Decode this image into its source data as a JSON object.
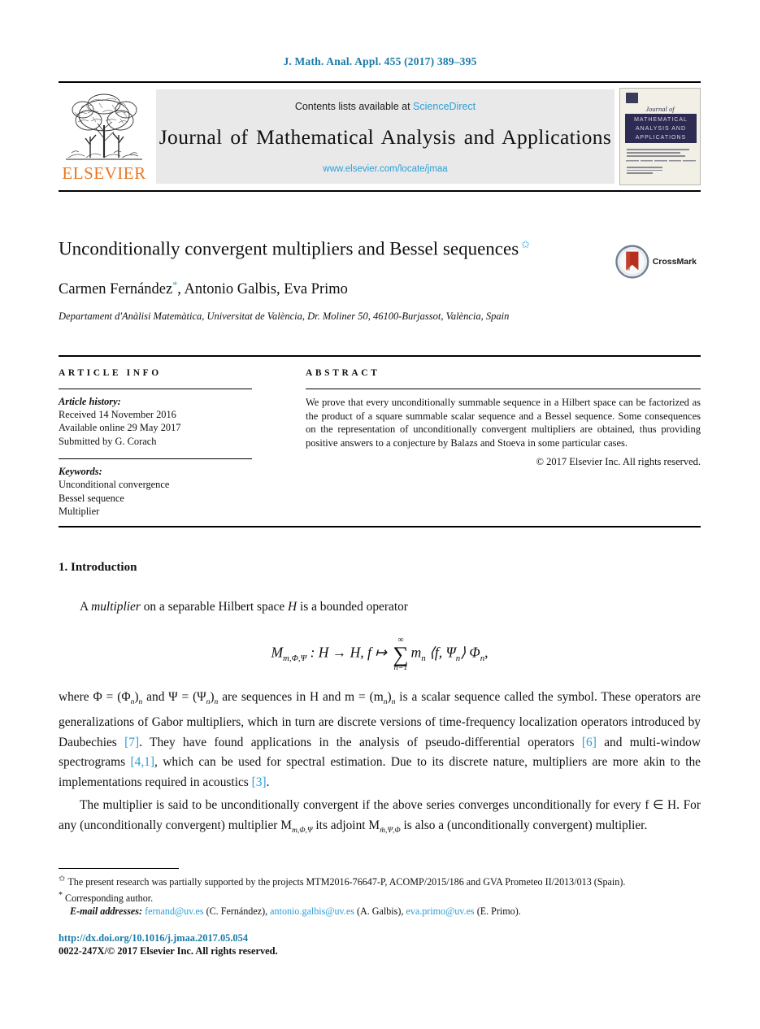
{
  "running_head": "J. Math. Anal. Appl. 455 (2017) 389–395",
  "masthead": {
    "contents_prefix": "Contents lists available at",
    "sciencedirect": "ScienceDirect",
    "journal_title": "Journal of Mathematical Analysis and Applications",
    "journal_url": "www.elsevier.com/locate/jmaa",
    "publisher_wordmark": "ELSEVIER",
    "cover": {
      "journal_of": "Journal of",
      "band_line1": "MATHEMATICAL",
      "band_line2": "ANALYSIS AND",
      "band_line3": "APPLICATIONS"
    }
  },
  "article": {
    "title": "Unconditionally convergent multipliers and Bessel sequences",
    "title_footnote_mark": "✩",
    "authors": "Carmen Fernández",
    "author_star": "*",
    "authors_rest": ", Antonio Galbis, Eva Primo",
    "affiliation": "Departament d'Anàlisi Matemàtica, Universitat de València, Dr. Moliner 50, 46100-Burjassot, València, Spain",
    "crossmark_label": "CrossMark"
  },
  "info": {
    "heading": "ARTICLE INFO",
    "history_label": "Article history:",
    "history": [
      "Received 14 November 2016",
      "Available online 29 May 2017",
      "Submitted by G. Corach"
    ],
    "keywords_label": "Keywords:",
    "keywords": [
      "Unconditional convergence",
      "Bessel sequence",
      "Multiplier"
    ]
  },
  "abstract": {
    "heading": "ABSTRACT",
    "text": "We prove that every unconditionally summable sequence in a Hilbert space can be factorized as the product of a square summable scalar sequence and a Bessel sequence. Some consequences on the representation of unconditionally convergent multipliers are obtained, thus providing positive answers to a conjecture by Balazs and Stoeva in some particular cases.",
    "copyright": "© 2017 Elsevier Inc. All rights reserved."
  },
  "body": {
    "section_heading": "1. Introduction",
    "p1_a": "A ",
    "p1_em": "multiplier",
    "p1_b": " on a separable Hilbert space ",
    "p1_H": "H",
    "p1_c": " is a bounded operator",
    "equation": {
      "operator": "M",
      "operator_sub": "m,Φ,Ψ",
      "maps": " : H → H,  f ↦ ",
      "sum_top": "∞",
      "sum_bot": "n=1",
      "term_m": "m",
      "term_m_sub": "n",
      "inner": " ⟨f, Ψ",
      "inner_sub": "n",
      "inner_close": "⟩ Φ",
      "phi_sub": "n",
      "tail": ","
    },
    "p2_part1": "where Φ = (Φ",
    "p2_part2": ")",
    "p2_text": " and Ψ = (Ψ",
    "p2_text2": " are sequences in H and m = (m",
    "p2_text3": " is a scalar sequence called the symbol. These operators are generalizations of Gabor multipliers, which in turn are discrete versions of time-frequency localization operators introduced by Daubechies ",
    "cite_7": "[7]",
    "p2_text4": ". They have found applications in the analysis of pseudo-differential operators ",
    "cite_6": "[6]",
    "p2_text5": " and multi-window spectrograms ",
    "cite_41": "[4,1]",
    "p2_text6": ", which can be used for spectral estimation. Due to its discrete nature, multipliers are more akin to the implementations required in acoustics ",
    "cite_3": "[3]",
    "p2_text7": ".",
    "p3_text1": "The multiplier is said to be unconditionally convergent if the above series converges unconditionally for every f ∈ H. For any (unconditionally convergent) multiplier M",
    "p3_sub1": "m,Φ,Ψ",
    "p3_text2": " its adjoint M",
    "p3_sub2": "m̄,Ψ,Φ",
    "p3_text3": " is also a (unconditionally convergent) multiplier."
  },
  "footnotes": {
    "funding_mark": "✩",
    "funding": "The present research was partially supported by the projects MTM2016-76647-P, ACOMP/2015/186 and GVA Prometeo II/2013/013 (Spain).",
    "corresponding_mark": "*",
    "corresponding": "Corresponding author.",
    "emails_label": "E-mail addresses:",
    "emails": [
      {
        "address": "fernand@uv.es",
        "owner": "(C. Fernández)"
      },
      {
        "address": "antonio.galbis@uv.es",
        "owner": "(A. Galbis)"
      },
      {
        "address": "eva.primo@uv.es",
        "owner": "(E. Primo)"
      }
    ],
    "doi": "http://dx.doi.org/10.1016/j.jmaa.2017.05.054",
    "issn_line": "0022-247X/© 2017 Elsevier Inc. All rights reserved."
  },
  "colors": {
    "link_blue": "#2a9fd6",
    "head_blue": "#1a7aa8",
    "elsevier_orange": "#E87722",
    "cover_navy": "#2e2b52",
    "crossmark_red": "#b7301f"
  }
}
